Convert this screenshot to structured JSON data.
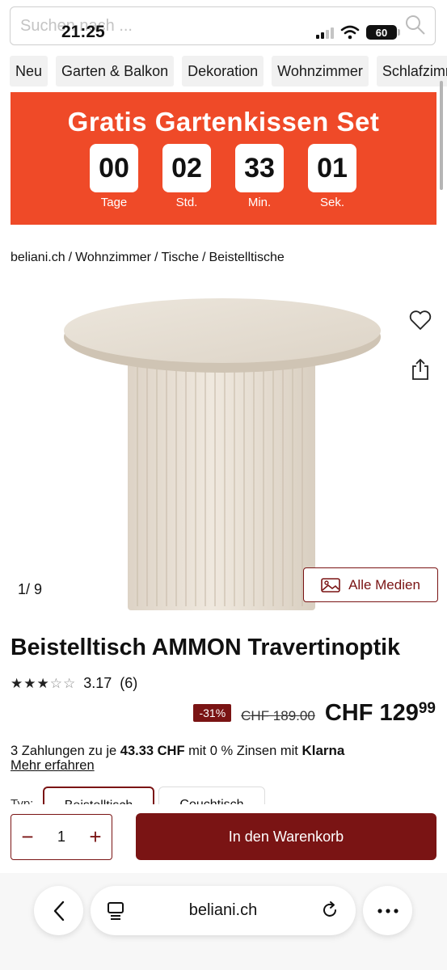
{
  "status": {
    "time": "21:25",
    "battery": "60"
  },
  "search": {
    "placeholder": "Suchen nach ..."
  },
  "categories": [
    "Neu",
    "Garten & Balkon",
    "Dekoration",
    "Wohnzimmer",
    "Schlafzimmer"
  ],
  "promo": {
    "title": "Gratis Gartenkissen Set",
    "countdown": [
      {
        "value": "00",
        "label": "Tage"
      },
      {
        "value": "02",
        "label": "Std."
      },
      {
        "value": "33",
        "label": "Min."
      },
      {
        "value": "01",
        "label": "Sek."
      }
    ],
    "bg_color": "#ef4a28"
  },
  "breadcrumb": [
    "beliani.ch",
    "Wohnzimmer",
    "Tische",
    "Beistelltische"
  ],
  "gallery": {
    "counter": "1/  9",
    "media_button": "Alle Medien"
  },
  "product": {
    "title": "Beistelltisch AMMON Travertinoptik",
    "rating_value": "3.17",
    "rating_count": "(6)",
    "stars_filled": 3,
    "stars_total": 5,
    "discount": "-31%",
    "old_price": "CHF 189.00",
    "price_main": "CHF 129",
    "price_cents": "99",
    "klarna_pre": "3 Zahlungen zu je ",
    "klarna_amount": "43.33 CHF",
    "klarna_mid": " mit 0 % Zinsen mit ",
    "klarna_brand": "Klarna",
    "more_link": "Mehr erfahren",
    "type_label": "Typ:",
    "type_options": [
      "Beistelltisch",
      "Couchtisch"
    ]
  },
  "purchase": {
    "quantity": "1",
    "minus": "−",
    "plus": "+",
    "cart_button": "In den Warenkorb"
  },
  "browser": {
    "url": "beliani.ch"
  },
  "colors": {
    "brand": "#7a1414",
    "promo": "#ef4a28"
  }
}
